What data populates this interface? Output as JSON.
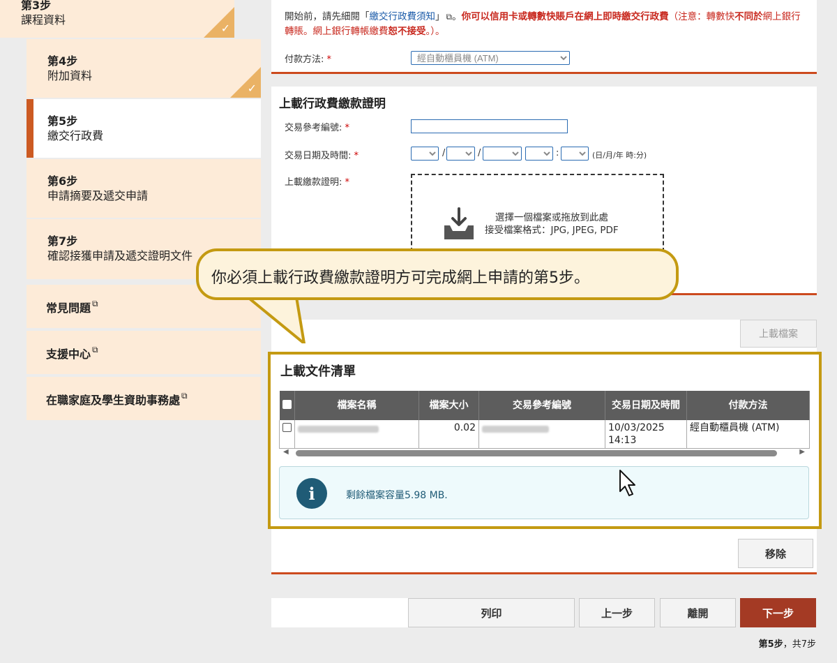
{
  "sidebar": {
    "steps": [
      {
        "num": "第3步",
        "name": "課程資料",
        "done": true
      },
      {
        "num": "第4步",
        "name": "附加資料",
        "done": true
      },
      {
        "num": "第5步",
        "name": "繳交行政費",
        "active": true
      },
      {
        "num": "第6步",
        "name": "申請摘要及遞交申請"
      },
      {
        "num": "第7步",
        "name": "確認接獲申請及遞交證明文件"
      }
    ],
    "links": [
      {
        "label": "常見問題"
      },
      {
        "label": "支援中心"
      },
      {
        "label": "在職家庭及學生資助事務處"
      }
    ],
    "ext_icon": "⧉"
  },
  "payment": {
    "note_pre": "開始前，請先細閱「",
    "note_link": "繳交行政費須知",
    "note_mid": "」",
    "note_ext": "⧉",
    "note_after_link": "。",
    "note_bold1": "你可以信用卡或轉數快賬戶在網上即時繳交行政費",
    "note_paren_open": "（注意：轉數快",
    "note_bold2": "不同於",
    "note_mid2": "網上銀行轉賬。網上銀行轉帳繳費",
    "note_bold3": "恕不接受",
    "note_end": "。）。",
    "method_label": "付款方法:",
    "required": "*",
    "method_value": "經自動櫃員機 (ATM)"
  },
  "upload_proof": {
    "title": "上載行政費繳款證明",
    "ref_label": "交易參考編號:",
    "datetime_label": "交易日期及時間:",
    "datetime_hint": "(日/月/年 時:分)",
    "date_sep": "/",
    "time_sep": ":",
    "upload_label": "上載繳款證明:",
    "drop_line1": "選擇一個檔案或拖放到此處",
    "drop_line2": "接受檔案格式：JPG, JPEG, PDF",
    "upload_button": "上載檔案"
  },
  "callout": {
    "text": "你必須上載行政費繳款證明方可完成網上申請的第5步。"
  },
  "documents": {
    "title": "上載文件清單",
    "columns": [
      "檔案名稱",
      "檔案大小",
      "交易參考編號",
      "交易日期及時間",
      "付款方法"
    ],
    "rows": [
      {
        "size": "0.02",
        "datetime": "10/03/2025 14:13",
        "method": "經自動櫃員機 (ATM)"
      }
    ],
    "info_text": "剩餘檔案容量5.98 MB.",
    "remove_button": "移除"
  },
  "footer": {
    "print_button": "列印",
    "prev_button": "上一步",
    "exit_button": "離開",
    "next_button": "下一步",
    "step_current": "第5步",
    "step_total": "，共7步"
  },
  "colors": {
    "accent_red": "#cc4a1e",
    "primary_button": "#a43a24",
    "highlight_gold": "#c49a12",
    "sidebar_bg": "#fdebd8"
  }
}
